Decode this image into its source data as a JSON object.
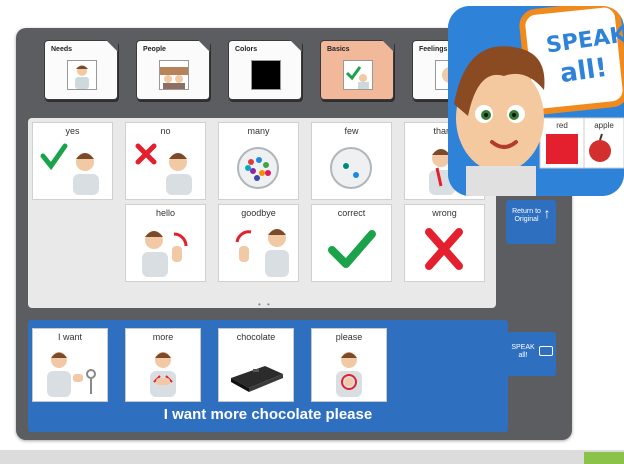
{
  "folders": [
    {
      "label": "Needs"
    },
    {
      "label": "People"
    },
    {
      "label": "Colors"
    },
    {
      "label": "Basics",
      "active": true
    },
    {
      "label": "Feelings"
    }
  ],
  "grid": {
    "row1": [
      "yes",
      "no",
      "many",
      "few",
      "thank"
    ],
    "row2": [
      "hello",
      "goodbye",
      "correct",
      "wrong"
    ],
    "pager_dots": "• •"
  },
  "side_buttons": {
    "return_label": "Return to Original",
    "speak_label": "SPEAK all!"
  },
  "sentence": {
    "words": [
      "I want",
      "more",
      "chocolate",
      "please"
    ],
    "text": "I want more chocolate please"
  },
  "logo": {
    "line1": "SPEAK",
    "line2": "all!",
    "card1": "red",
    "card2": "apple"
  },
  "colors": {
    "accent_blue": "#2f6fc0",
    "device_gray": "#5b5d60",
    "active_folder": "#f2b89a",
    "check_green": "#1aa34a",
    "cross_red": "#e5202e"
  }
}
